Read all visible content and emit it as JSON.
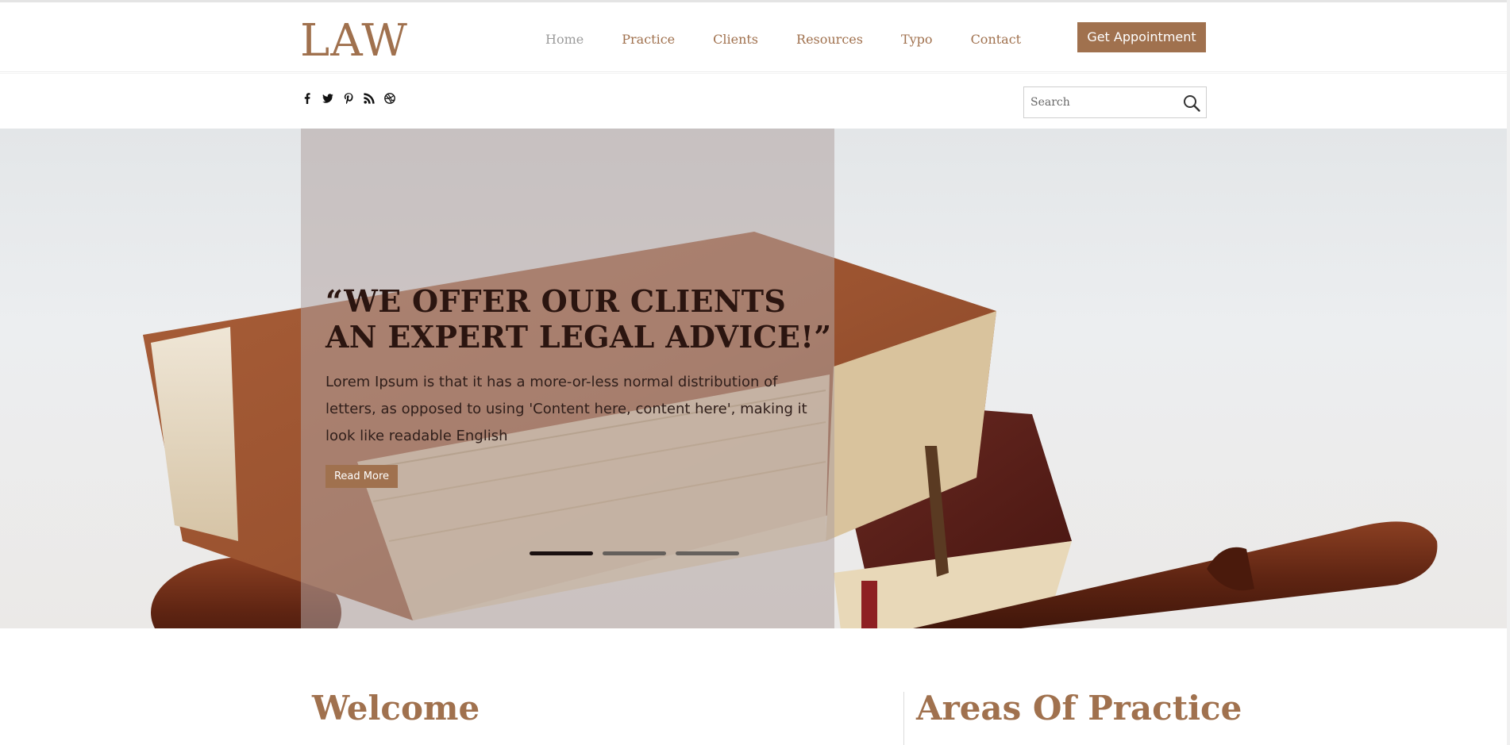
{
  "brand": {
    "logo": "LAW",
    "accent": "#a0714e"
  },
  "nav": {
    "items": [
      "Home",
      "Practice",
      "Clients",
      "Resources",
      "Typo",
      "Contact"
    ],
    "active": "Home"
  },
  "header": {
    "appointment_label": "Get Appointment"
  },
  "social": {
    "icons": [
      "facebook-icon",
      "twitter-icon",
      "pinterest-icon",
      "rss-icon",
      "dribbble-icon"
    ]
  },
  "search": {
    "placeholder": "Search",
    "value": ""
  },
  "hero": {
    "title": "“WE OFFER OUR CLIENTS AN EXPERT LEGAL ADVICE!”",
    "text": "Lorem Ipsum is that it has a more-or-less normal distribution of letters, as opposed to using 'Content here, content here', making it look like readable English",
    "button_label": "Read More",
    "slides": 3,
    "active_slide": 1
  },
  "sections": {
    "welcome_title": "Welcome",
    "practice_title": "Areas Of Practice"
  }
}
